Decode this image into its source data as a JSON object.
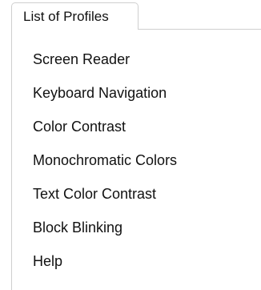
{
  "tab": {
    "label": "List of Profiles"
  },
  "profiles": [
    {
      "label": "Screen Reader"
    },
    {
      "label": "Keyboard Navigation"
    },
    {
      "label": "Color Contrast"
    },
    {
      "label": "Monochromatic Colors"
    },
    {
      "label": "Text Color Contrast"
    },
    {
      "label": "Block Blinking"
    },
    {
      "label": "Help"
    }
  ]
}
